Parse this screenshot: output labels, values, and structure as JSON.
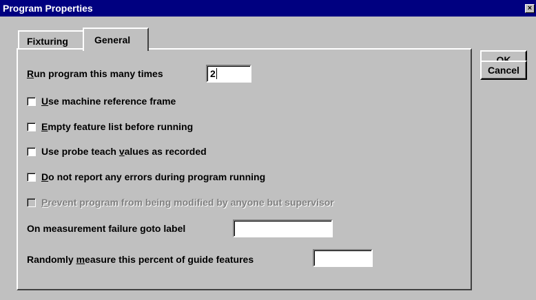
{
  "window": {
    "title": "Program Properties",
    "close_glyph": "×"
  },
  "tabs": [
    {
      "label": "Fixturing",
      "active": false
    },
    {
      "label": "General",
      "active": true
    }
  ],
  "general": {
    "run_times": {
      "label_access": "R",
      "label_rest": "un program this many times",
      "value": "2"
    },
    "checkboxes": [
      {
        "pre": "",
        "access": "U",
        "post": "se machine reference frame",
        "checked": false,
        "enabled": true
      },
      {
        "pre": "",
        "access": "E",
        "post": "mpty feature list before running",
        "checked": false,
        "enabled": true
      },
      {
        "pre": "Use probe teach ",
        "access": "v",
        "post": "alues as recorded",
        "checked": false,
        "enabled": true
      },
      {
        "pre": "",
        "access": "D",
        "post": "o not report any errors during program running",
        "checked": false,
        "enabled": true
      },
      {
        "pre": "",
        "access": "P",
        "post": "revent program from being modified by anyone but supervisor",
        "checked": false,
        "enabled": false
      }
    ],
    "goto_label": {
      "label": "On measurement failure goto label",
      "value": ""
    },
    "random_measure": {
      "pre": "Randomly ",
      "access": "m",
      "post": "easure this percent of guide features",
      "value": ""
    }
  },
  "buttons": {
    "ok": "OK",
    "cancel": "Cancel"
  }
}
